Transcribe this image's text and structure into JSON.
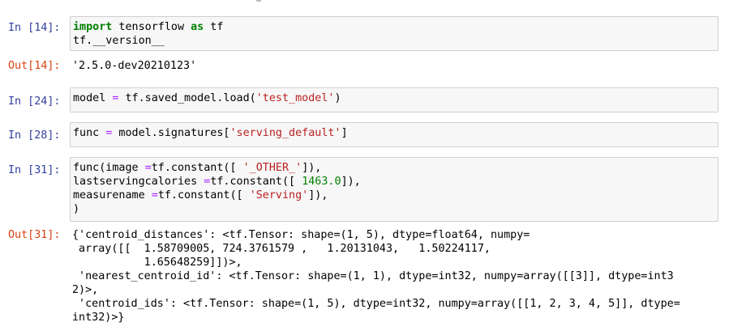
{
  "cells": [
    {
      "in_prompt": "In [14]:",
      "code_lines": [
        [
          {
            "t": "kw",
            "v": "import"
          },
          {
            "t": "plain",
            "v": " tensorflow "
          },
          {
            "t": "kw",
            "v": "as"
          },
          {
            "t": "plain",
            "v": " tf"
          }
        ],
        [
          {
            "t": "plain",
            "v": "tf.__version__"
          }
        ]
      ],
      "out_prompt": "Out[14]:",
      "output_lines": [
        "'2.5.0-dev20210123'"
      ]
    },
    {
      "in_prompt": "In [24]:",
      "code_lines": [
        [
          {
            "t": "plain",
            "v": "model "
          },
          {
            "t": "op",
            "v": "="
          },
          {
            "t": "plain",
            "v": " tf.saved_model.load("
          },
          {
            "t": "str",
            "v": "'test_model'"
          },
          {
            "t": "plain",
            "v": ")"
          }
        ]
      ]
    },
    {
      "in_prompt": "In [28]:",
      "code_lines": [
        [
          {
            "t": "plain",
            "v": "func "
          },
          {
            "t": "op",
            "v": "="
          },
          {
            "t": "plain",
            "v": " model.signatures["
          },
          {
            "t": "str",
            "v": "'serving_default'"
          },
          {
            "t": "plain",
            "v": "]"
          }
        ]
      ]
    },
    {
      "in_prompt": "In [31]:",
      "code_lines": [
        [
          {
            "t": "plain",
            "v": "func(image "
          },
          {
            "t": "op",
            "v": "="
          },
          {
            "t": "plain",
            "v": "tf.constant([ "
          },
          {
            "t": "str",
            "v": "'_OTHER_'"
          },
          {
            "t": "plain",
            "v": "]),"
          }
        ],
        [
          {
            "t": "plain",
            "v": "lastservingcalories "
          },
          {
            "t": "op",
            "v": "="
          },
          {
            "t": "plain",
            "v": "tf.constant([ "
          },
          {
            "t": "num",
            "v": "1463.0"
          },
          {
            "t": "plain",
            "v": "]),"
          }
        ],
        [
          {
            "t": "plain",
            "v": "measurename "
          },
          {
            "t": "op",
            "v": "="
          },
          {
            "t": "plain",
            "v": "tf.constant([ "
          },
          {
            "t": "str",
            "v": "'Serving'"
          },
          {
            "t": "plain",
            "v": "]),"
          }
        ],
        [
          {
            "t": "plain",
            "v": ")"
          }
        ]
      ],
      "out_prompt": "Out[31]:",
      "output_lines": [
        "{'centroid_distances': <tf.Tensor: shape=(1, 5), dtype=float64, numpy=",
        " array([[  1.58709005, 724.3761579 ,   1.20131043,   1.50224117,",
        "           1.65648259]])>,",
        " 'nearest_centroid_id': <tf.Tensor: shape=(1, 1), dtype=int32, numpy=array([[3]], dtype=int3",
        "2)>,",
        " 'centroid_ids': <tf.Tensor: shape=(1, 5), dtype=int32, numpy=array([[1, 2, 3, 4, 5]], dtype=",
        "int32)>}"
      ]
    }
  ],
  "colors": {
    "in_prompt": "#303f9f",
    "out_prompt": "#d84315",
    "keyword": "#008000",
    "operator": "#aa22ff",
    "string": "#ba2121",
    "number": "#008000",
    "input_bg": "#f7f7f7",
    "input_border": "#cfcfcf"
  }
}
